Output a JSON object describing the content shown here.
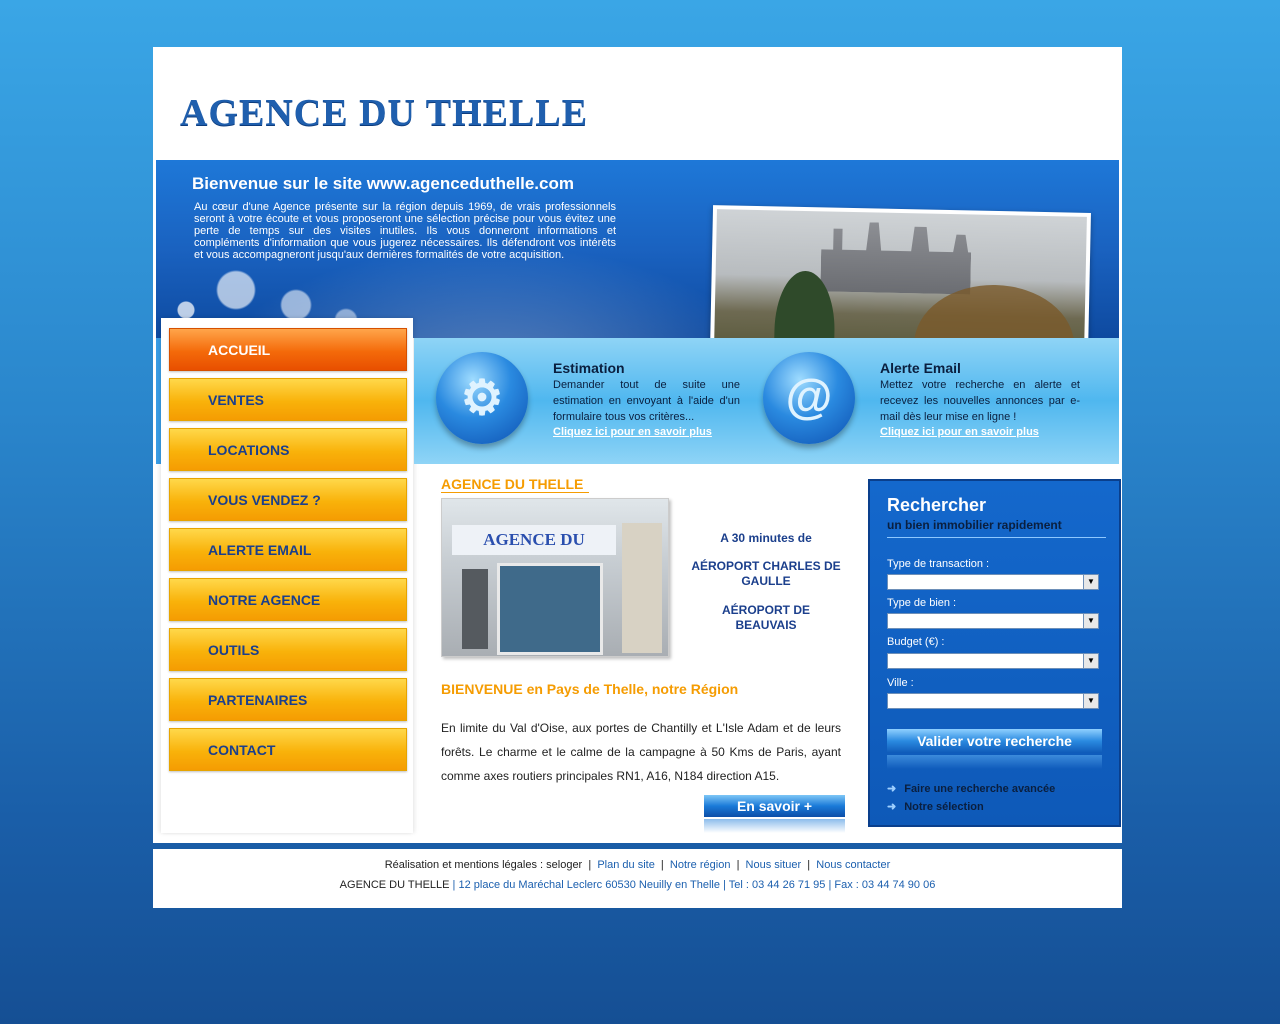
{
  "header": {
    "logo": "AGENCE DU THELLE",
    "welcome_title": "Bienvenue sur le site www.agenceduthelle.com",
    "welcome_text": "Au cœur d'une Agence présente sur la région depuis 1969, de vrais professionnels seront à votre écoute et vous proposeront une sélection précise pour vous évitez une perte de temps sur des visites inutiles. Ils vous donneront informations et compléments d'information que vous jugerez nécessaires. Ils défendront vos intérêts et vous accompagneront jusqu'aux dernières formalités de votre acquisition."
  },
  "nav": {
    "items": [
      {
        "label": "ACCUEIL"
      },
      {
        "label": "VENTES"
      },
      {
        "label": "LOCATIONS"
      },
      {
        "label": "VOUS VENDEZ ?"
      },
      {
        "label": "ALERTE EMAIL"
      },
      {
        "label": "NOTRE AGENCE"
      },
      {
        "label": "OUTILS"
      },
      {
        "label": "PARTENAIRES"
      },
      {
        "label": "CONTACT"
      }
    ]
  },
  "info": {
    "estimation": {
      "title": "Estimation",
      "text": "Demander tout de suite une estimation en envoyant à l'aide d'un formulaire tous vos critères...",
      "link": "Cliquez ici pour en savoir plus",
      "icon": "gear-icon"
    },
    "alert": {
      "title": "Alerte Email",
      "text": "Mettez votre recherche en alerte et recevez les nouvelles annonces par e-mail dès leur mise en ligne !",
      "link": "Cliquez ici pour en savoir plus",
      "icon": "at-icon"
    }
  },
  "main": {
    "agency_heading": "AGENCE DU THELLE",
    "photo_sign": "AGENCE DU THELLE",
    "dist1": "A 30 minutes de",
    "dist2": "AÉROPORT CHARLES DE GAULLE",
    "dist3": "AÉROPORT DE BEAUVAIS",
    "bienvenue": "BIENVENUE en Pays de Thelle, notre Région",
    "body": "En limite du Val d'Oise, aux portes de Chantilly et L'Isle Adam et de leurs forêts. Le charme et le calme de la campagne à 50 Kms de Paris, ayant comme axes routiers principales RN1, A16, N184 direction A15.",
    "more_button": "En savoir +"
  },
  "search": {
    "title": "Rechercher",
    "subtitle": "un bien immobilier rapidement",
    "fields": [
      {
        "label": "Type de transaction :"
      },
      {
        "label": "Type de bien :"
      },
      {
        "label": "Budget (€) :"
      },
      {
        "label": "Ville :"
      }
    ],
    "validate": "Valider votre recherche",
    "link_advanced": "Faire une recherche avancée",
    "link_selection": "Notre sélection"
  },
  "footer": {
    "realisation": "Réalisation et mentions légales : seloger",
    "links": [
      "Plan du site",
      "Notre région",
      "Nous situer",
      "Nous contacter"
    ],
    "agency": "AGENCE DU THELLE",
    "address": "12 place du Maréchal Leclerc 60530 Neuilly en Thelle",
    "tel": "Tel : 03 44 26 71 95",
    "fax": "Fax : 03 44 74 90 06"
  },
  "colors": {
    "accent_orange": "#f59c02",
    "nav_blue": "#1b3f8c",
    "brand_blue": "#1f5fae"
  }
}
